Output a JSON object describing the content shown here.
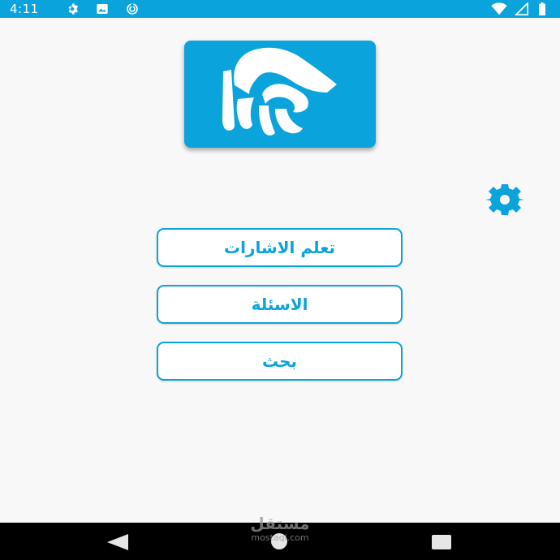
{
  "status_bar": {
    "time": "4:11",
    "left_icons": [
      "settings-icon",
      "image-icon",
      "sync-icon"
    ],
    "right_icons": [
      "wifi-icon",
      "signal-icon",
      "battery-icon"
    ],
    "color": "#0aa3dc"
  },
  "app": {
    "accent_color": "#0aa3dc",
    "logo_icon": "hand-logo-icon",
    "settings_icon": "gear-icon"
  },
  "menu": {
    "learn_signs": "تعلم الاشارات",
    "questions": "الاسئلة",
    "search": "بحث"
  },
  "nav_bar": {
    "items": [
      "back-icon",
      "home-icon",
      "recents-icon"
    ]
  },
  "watermark": {
    "arabic": "مستقل",
    "latin": "mostaql.com"
  }
}
